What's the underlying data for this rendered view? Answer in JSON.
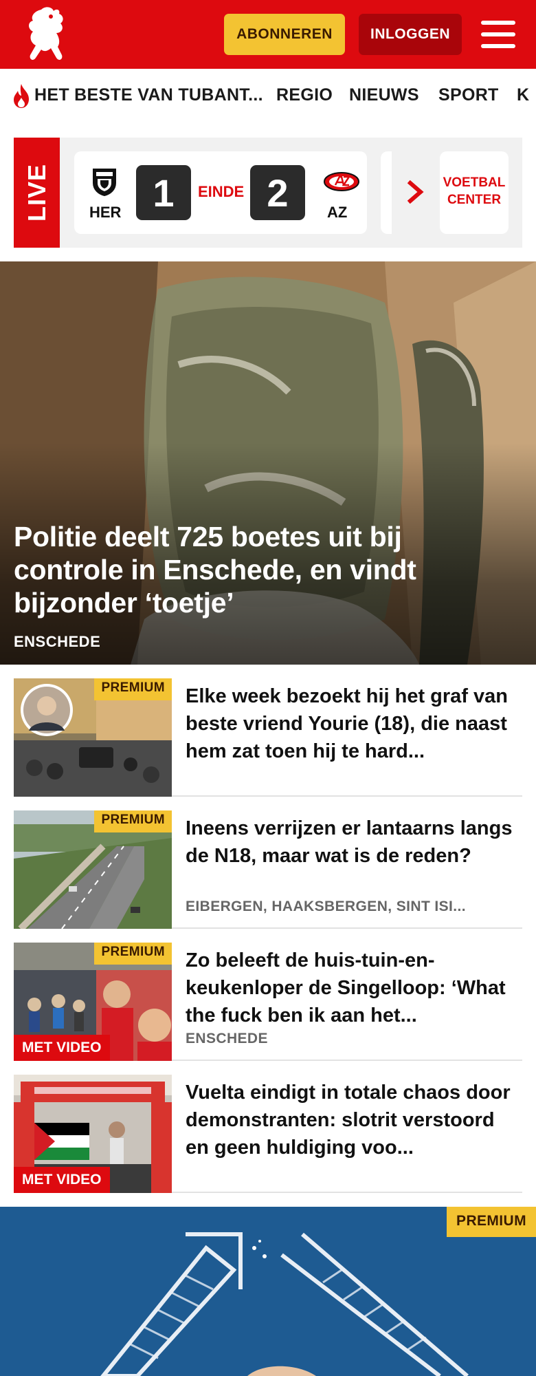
{
  "header": {
    "subscribe_label": "ABONNEREN",
    "login_label": "INLOGGEN"
  },
  "nav": {
    "items": [
      {
        "label": "HET BESTE VAN TUBANT..."
      },
      {
        "label": "REGIO"
      },
      {
        "label": "NIEUWS"
      },
      {
        "label": "SPORT"
      },
      {
        "label": "K"
      }
    ]
  },
  "live": {
    "tag": "LIVE",
    "match": {
      "home_team": "HER",
      "home_score": "1",
      "status": "EINDE",
      "away_score": "2",
      "away_team": "AZ"
    },
    "football_center": {
      "line1": "VOETBAL",
      "line2": "CENTER"
    }
  },
  "hero": {
    "title": "Politie deelt 725 boetes uit bij controle in Enschede, en vindt bijzonder ‘toetje’",
    "location": "ENSCHEDE"
  },
  "articles": [
    {
      "title": "Elke week bezoekt hij het graf van beste vriend Yourie (18), die naast hem zat toen hij te hard...",
      "premium": "PREMIUM"
    },
    {
      "title": "Ineens verrijzen er lantaarns langs de N18, maar wat is de reden?",
      "location": "EIBERGEN, HAAKSBERGEN, SINT ISI...",
      "premium": "PREMIUM"
    },
    {
      "title": "Zo beleeft de huis-tuin-en-keukenloper de Singelloop: ‘What the fuck ben ik aan het...",
      "location": "ENSCHEDE",
      "premium": "PREMIUM",
      "video": "MET VIDEO"
    },
    {
      "title": "Vuelta eindigt in totale chaos door demonstranten: slotrit verstoord en geen huldiging voo...",
      "video": "MET VIDEO"
    }
  ],
  "promo": {
    "premium": "PREMIUM"
  },
  "colors": {
    "brand_red": "#dd0a0f",
    "dark_red": "#a9050a",
    "premium_yellow": "#f3c332"
  },
  "icons": [
    "twente-horse-logo",
    "menu-icon",
    "flame-icon",
    "heracles-crest",
    "az-crest",
    "chevron-right-icon"
  ]
}
